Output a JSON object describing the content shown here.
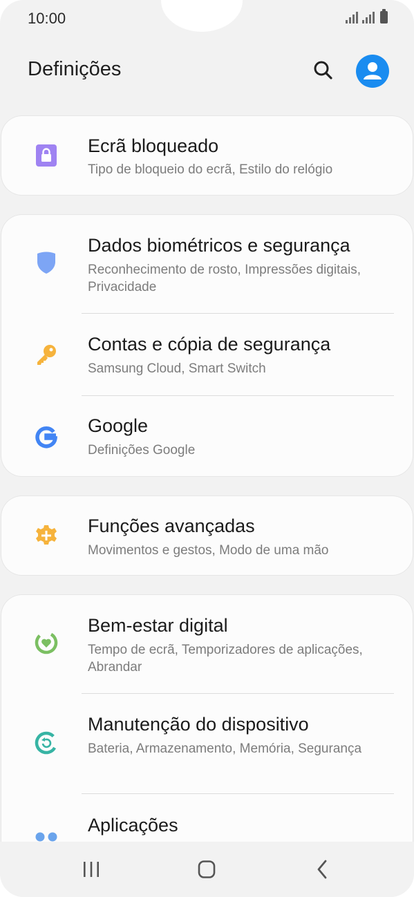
{
  "status_bar": {
    "time": "10:00"
  },
  "header": {
    "title": "Definições"
  },
  "items": [
    {
      "title": "Ecrã bloqueado",
      "subtitle": "Tipo de bloqueio do ecrã, Estilo do relógio",
      "icon": "lock-icon",
      "color": "#9f83f2"
    },
    {
      "title": "Dados biométricos e segurança",
      "subtitle": "Reconhecimento de rosto, Impressões digitais, Privacidade",
      "icon": "shield-icon",
      "color": "#7da5f5"
    },
    {
      "title": "Contas e cópia de segurança",
      "subtitle": "Samsung Cloud, Smart Switch",
      "icon": "key-icon",
      "color": "#f6b33c"
    },
    {
      "title": "Google",
      "subtitle": "Definições Google",
      "icon": "google-icon",
      "color": "#4285f4"
    },
    {
      "title": "Funções avançadas",
      "subtitle": "Movimentos e gestos, Modo de uma mão",
      "icon": "gear-plus-icon",
      "color": "#f6b33c"
    },
    {
      "title": "Bem-estar digital",
      "subtitle": "Tempo de ecrã, Temporizadores de aplicações, Abrandar",
      "icon": "digital-wellbeing-icon",
      "color": "#7bbf62"
    },
    {
      "title": "Manutenção do dispositivo",
      "subtitle": "Bateria, Armazenamento, Memória, Segurança",
      "icon": "device-care-icon",
      "color": "#37b4a4"
    },
    {
      "title": "Aplicações",
      "subtitle": "",
      "icon": "apps-icon",
      "color": "#6aa4ec"
    }
  ],
  "navbar": {
    "icons": [
      "recent-apps-icon",
      "home-icon",
      "back-icon"
    ]
  }
}
